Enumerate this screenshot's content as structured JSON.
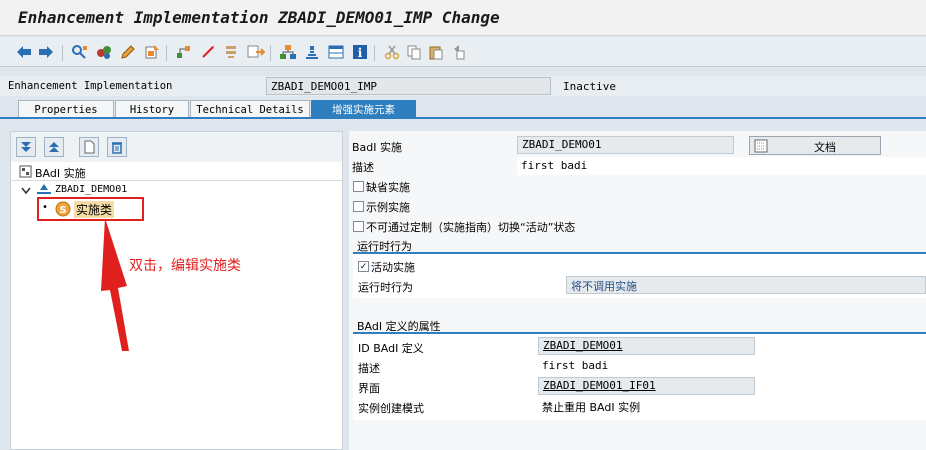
{
  "window": {
    "title": "Enhancement Implementation ZBADI_DEMO01_IMP Change"
  },
  "toolbar": {
    "icons": [
      "back-icon",
      "forward-icon",
      "other-object-icon",
      "display-change-icon",
      "edit-icon",
      "activate-icon",
      "where-used-icon",
      "object-list-icon",
      "navigate-icon",
      "hierarchy-icon",
      "tree-icon",
      "display-object-icon",
      "info-icon",
      "cut-icon",
      "copy-icon",
      "paste-icon",
      "undo-icon"
    ]
  },
  "header": {
    "enh_label": "Enhancement Implementation",
    "enh_value": "ZBADI_DEMO01_IMP",
    "status": "Inactive"
  },
  "tabs": [
    {
      "label": "Properties"
    },
    {
      "label": "History"
    },
    {
      "label": "Technical Details"
    },
    {
      "label": "增强实施元素"
    }
  ],
  "tree": {
    "header": "BAdI 实施",
    "root": "ZBADI_DEMO01",
    "child": "实施类"
  },
  "annotation": {
    "text": "双击，编辑实施类",
    "color": "#e0201f"
  },
  "detail": {
    "badi_impl_label": "BadI 实施",
    "badi_impl_value": "ZBADI_DEMO01",
    "doc_button": "文档",
    "desc_label": "描述",
    "desc_value": "first badi",
    "checkboxes": [
      {
        "label": "缺省实施",
        "checked": false
      },
      {
        "label": "示例实施",
        "checked": false
      },
      {
        "label": "不可通过定制（实施指南）切换“活动”状态",
        "checked": false
      }
    ],
    "runtime_section": "运行时行为",
    "active_label": "活动实施",
    "active_checked": true,
    "runtime_label": "运行时行为",
    "runtime_value": "将不调用实施",
    "def_section": "BAdI 定义的属性",
    "def_rows": [
      {
        "label": "ID BAdI 定义",
        "value": "ZBADI_DEMO01"
      },
      {
        "label": "描述",
        "value": "first badi"
      },
      {
        "label": "界面",
        "value": "ZBADI_DEMO01_IF01"
      },
      {
        "label": "实例创建模式",
        "value": "禁止重用 BAdI 实例"
      }
    ]
  },
  "colors": {
    "accent": "#2e7fbf",
    "annotation": "#e0201f"
  }
}
